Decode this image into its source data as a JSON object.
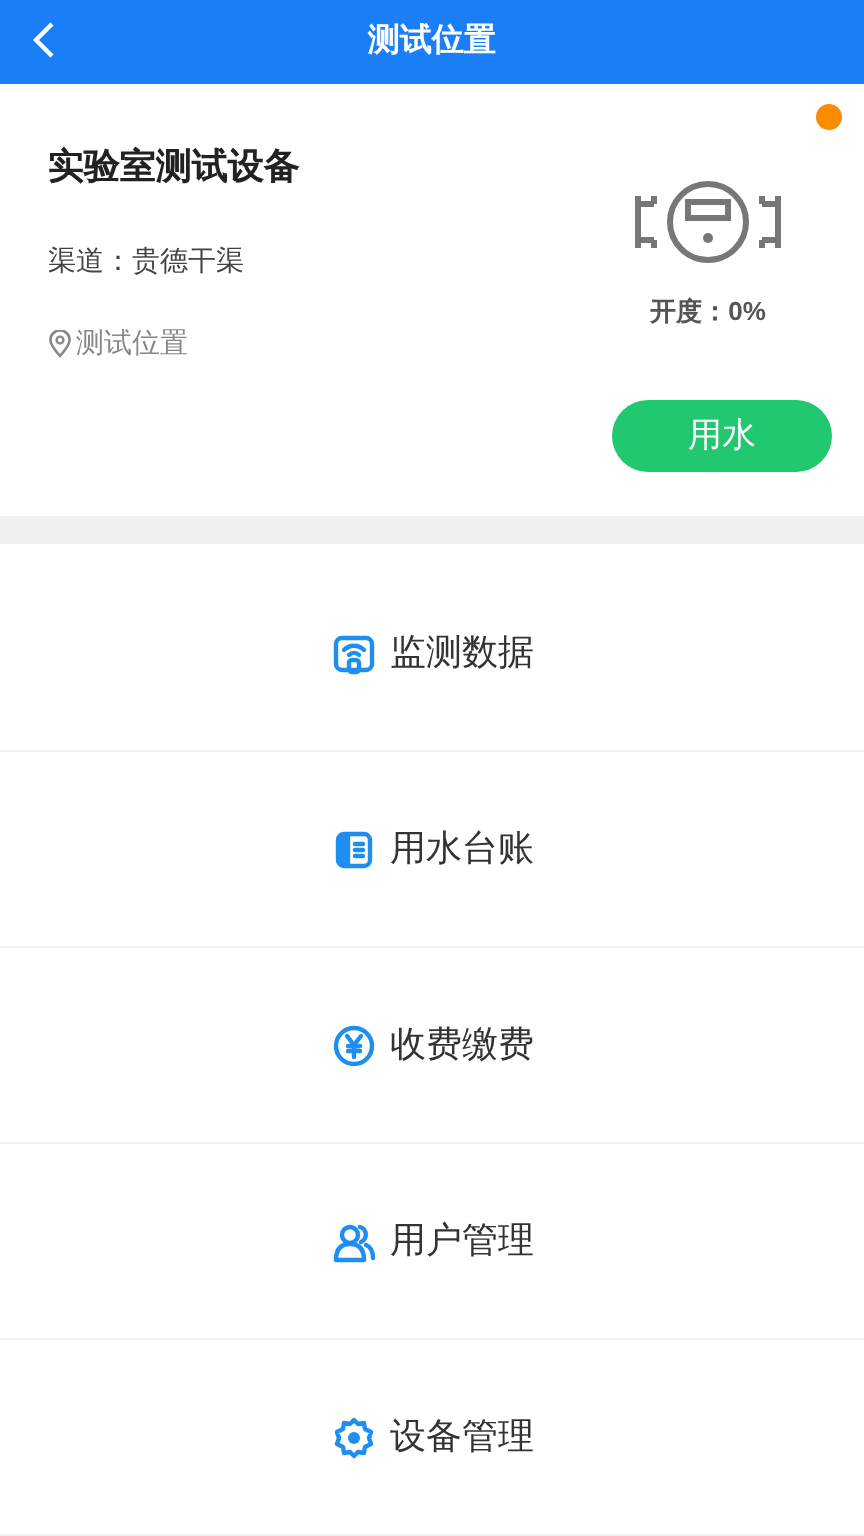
{
  "header": {
    "title": "测试位置"
  },
  "device": {
    "name": "实验室测试设备",
    "channel": "渠道：贵德干渠",
    "location": "测试位置",
    "opening": "开度：0%",
    "status": {
      "color": "#fb8c00"
    },
    "action": "用水"
  },
  "menu": [
    {
      "label": "监测数据"
    },
    {
      "label": "用水台账"
    },
    {
      "label": "收费缴费"
    },
    {
      "label": "用户管理"
    },
    {
      "label": "设备管理"
    }
  ]
}
